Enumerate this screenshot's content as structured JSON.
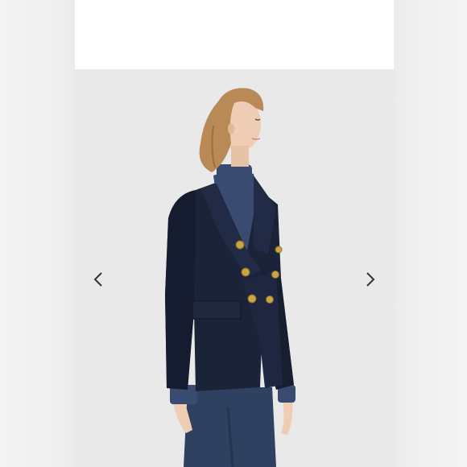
{
  "viewer": {
    "image": {
      "subject": "product-photo",
      "colors": {
        "backdrop": "#e8e8e8",
        "jacket": "#1b2338",
        "jacket_shadow": "#141a2c",
        "buttons": "#c9a544",
        "turtleneck": "#3a4b72",
        "jeans": "#2f4160",
        "hair": "#b98a55",
        "skin": "#efcdb4"
      }
    },
    "navigation": {
      "prev_icon": "chevron-left-icon",
      "next_icon": "chevron-right-icon",
      "arrow_color": "#333333"
    }
  }
}
